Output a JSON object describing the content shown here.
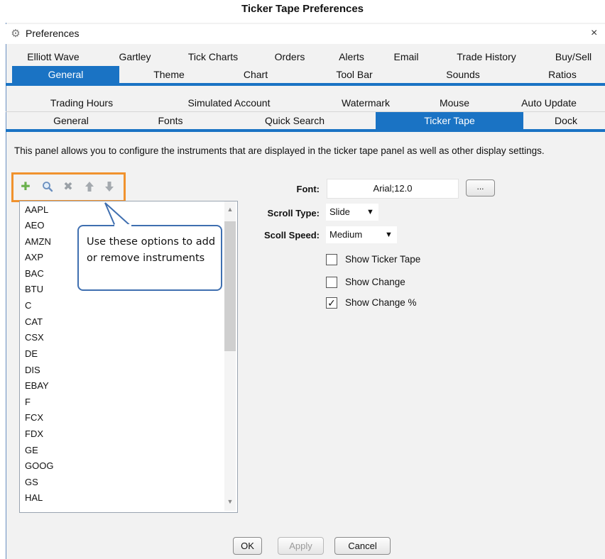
{
  "caption": "Ticker Tape Preferences",
  "window": {
    "title": "Preferences",
    "close": "×"
  },
  "tabs_row1": [
    "Elliott Wave",
    "Gartley",
    "Tick Charts",
    "Orders",
    "Alerts",
    "Email",
    "Trade History",
    "Buy/Sell"
  ],
  "tabs_row2": [
    "General",
    "Theme",
    "Chart",
    "Tool Bar",
    "Sounds",
    "Ratios"
  ],
  "tabs_row3": [
    "Trading Hours",
    "Simulated Account",
    "Watermark",
    "Mouse",
    "Auto Update"
  ],
  "tabs_row4": [
    "General",
    "Fonts",
    "Quick Search",
    "Ticker Tape",
    "Dock"
  ],
  "selected_tabs": {
    "row2": "General",
    "row4": "Ticker Tape"
  },
  "description": "This panel allows you to configure the instruments that are displayed in the ticker tape panel as well as other display settings.",
  "toolbar_icons": [
    "add-icon",
    "search-icon",
    "remove-icon",
    "move-up-icon",
    "move-down-icon"
  ],
  "instruments": [
    "AAPL",
    "AEO",
    "AMZN",
    "AXP",
    "BAC",
    "BTU",
    "C",
    "CAT",
    "CSX",
    "DE",
    "DIS",
    "EBAY",
    "F",
    "FCX",
    "FDX",
    "GE",
    "GOOG",
    "GS",
    "HAL"
  ],
  "callout_text": "Use these options to add or remove instruments",
  "settings": {
    "font_label": "Font:",
    "font_value": "Arial;12.0",
    "font_button": "...",
    "scroll_type_label": "Scroll Type:",
    "scroll_type_value": "Slide",
    "scroll_speed_label": "Scoll Speed:",
    "scroll_speed_value": "Medium",
    "show_ticker_tape": {
      "label": "Show Ticker Tape",
      "checked": false
    },
    "show_change": {
      "label": "Show Change",
      "checked": false
    },
    "show_change_pct": {
      "label": "Show Change %",
      "checked": true
    }
  },
  "buttons": {
    "ok": "OK",
    "apply": "Apply",
    "cancel": "Cancel"
  },
  "colors": {
    "accent": "#1a73c4",
    "highlight_border": "#f0922e",
    "callout_border": "#3f6fb0"
  }
}
